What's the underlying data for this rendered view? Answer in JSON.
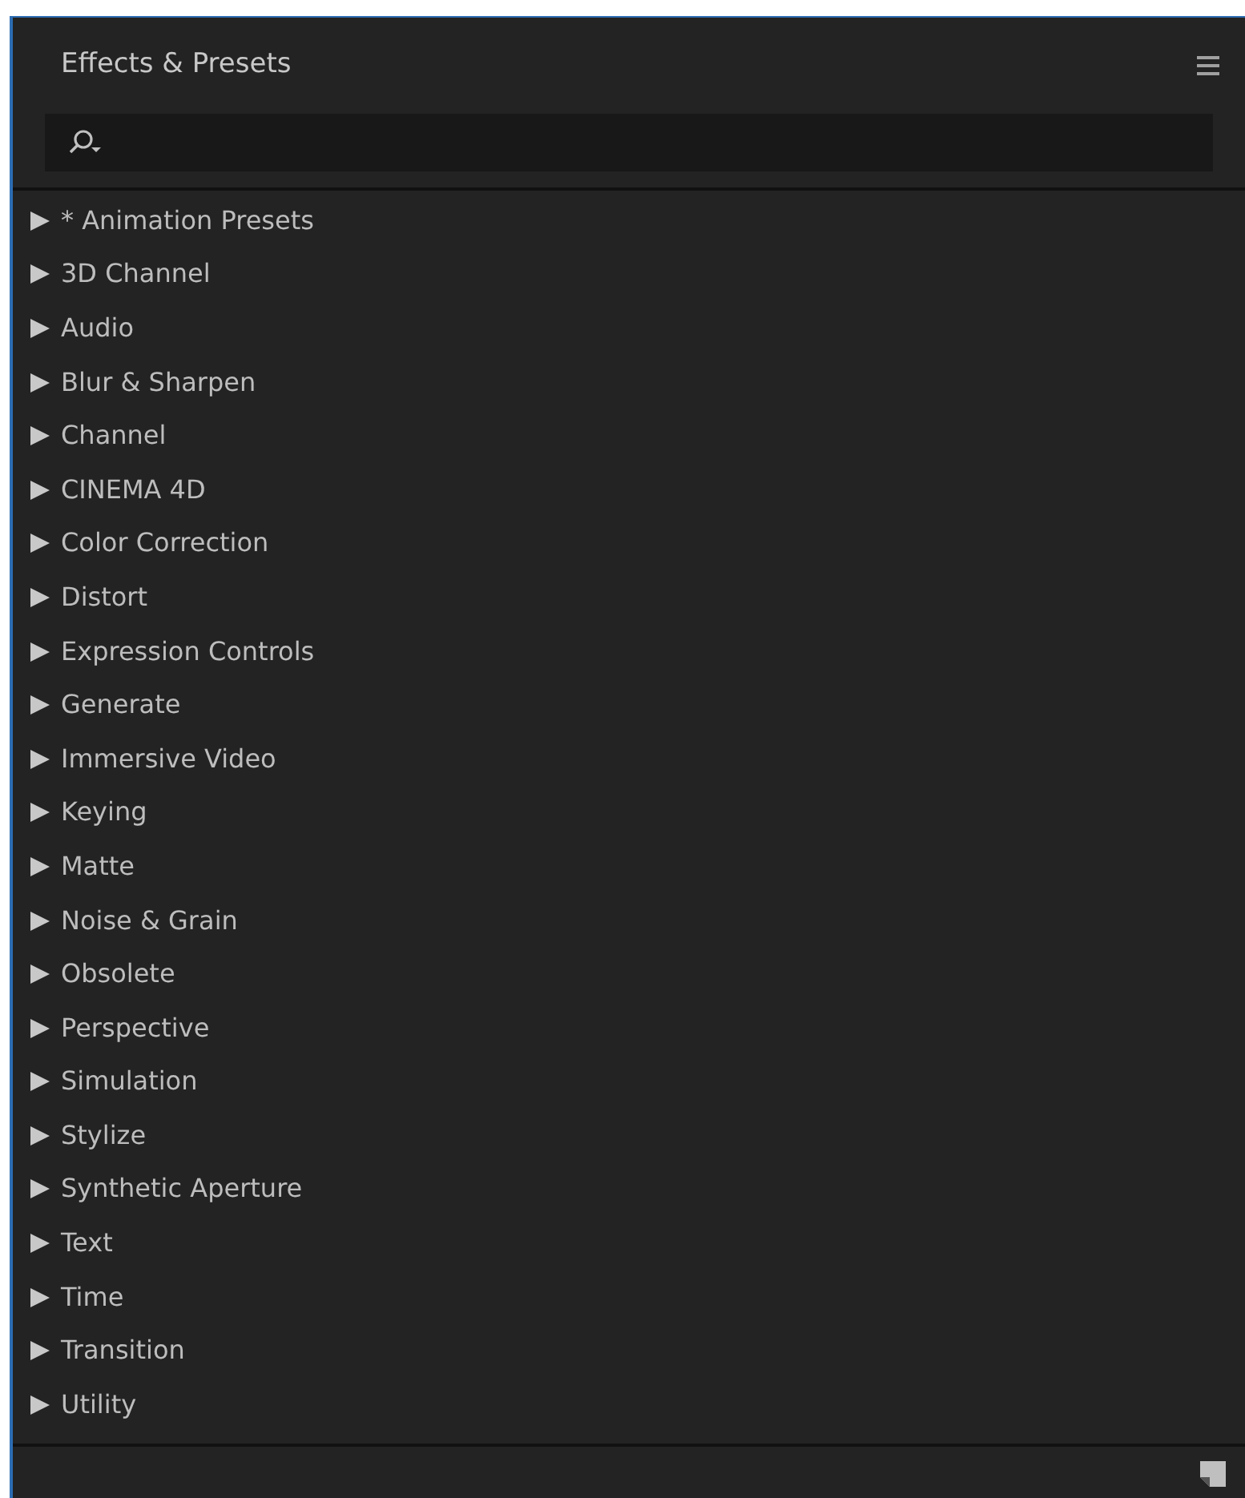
{
  "panel": {
    "title": "Effects & Presets"
  },
  "categories": [
    {
      "label": "* Animation Presets",
      "expanded": false
    },
    {
      "label": "3D Channel",
      "expanded": false
    },
    {
      "label": "Audio",
      "expanded": false
    },
    {
      "label": "Blur & Sharpen",
      "expanded": false
    },
    {
      "label": "Channel",
      "expanded": false
    },
    {
      "label": "CINEMA 4D",
      "expanded": false
    },
    {
      "label": "Color Correction",
      "expanded": false
    },
    {
      "label": "Distort",
      "expanded": false
    },
    {
      "label": "Expression Controls",
      "expanded": false
    },
    {
      "label": "Generate",
      "expanded": false
    },
    {
      "label": "Immersive Video",
      "expanded": false
    },
    {
      "label": "Keying",
      "expanded": false
    },
    {
      "label": "Matte",
      "expanded": false
    },
    {
      "label": "Noise & Grain",
      "expanded": false
    },
    {
      "label": "Obsolete",
      "expanded": false
    },
    {
      "label": "Perspective",
      "expanded": false
    },
    {
      "label": "Simulation",
      "expanded": false
    },
    {
      "label": "Stylize",
      "expanded": false
    },
    {
      "label": "Synthetic Aperture",
      "expanded": false
    },
    {
      "label": "Text",
      "expanded": false
    },
    {
      "label": "Time",
      "expanded": false
    },
    {
      "label": "Transition",
      "expanded": false
    },
    {
      "label": "Utility",
      "expanded": false
    }
  ]
}
